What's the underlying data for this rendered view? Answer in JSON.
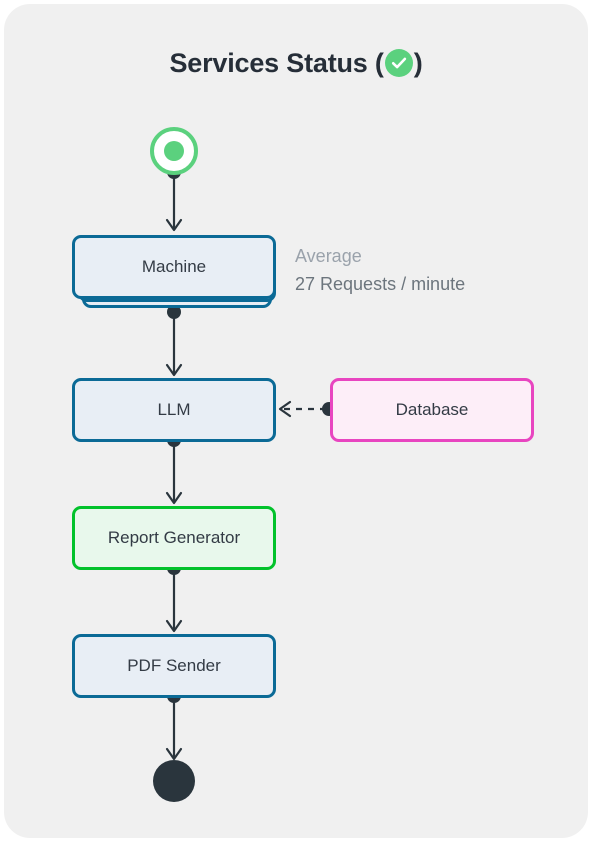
{
  "title": {
    "text_before": "Services Status (",
    "text_after": ")",
    "status_icon": "check-circle-icon",
    "status_color": "#5bd17e"
  },
  "diagram": {
    "type": "flowchart",
    "nodes": [
      {
        "id": "start",
        "label": "",
        "shape": "start-circle",
        "color": "#5bd17e"
      },
      {
        "id": "machine",
        "label": "Machine",
        "shape": "stacked-box",
        "color": "#0b6a96",
        "fill": "#e8eef5"
      },
      {
        "id": "llm",
        "label": "LLM",
        "shape": "box",
        "color": "#0b6a96",
        "fill": "#e8eef5"
      },
      {
        "id": "database",
        "label": "Database",
        "shape": "box",
        "color": "#e845c0",
        "fill": "#fdeef8"
      },
      {
        "id": "report",
        "label": "Report Generator",
        "shape": "box",
        "color": "#02c22b",
        "fill": "#e8f8ec"
      },
      {
        "id": "pdf",
        "label": "PDF Sender",
        "shape": "box",
        "color": "#0b6a96",
        "fill": "#e8eef5"
      },
      {
        "id": "end",
        "label": "",
        "shape": "end-circle",
        "color": "#2a353d"
      }
    ],
    "edges": [
      {
        "from": "start",
        "to": "machine",
        "style": "solid"
      },
      {
        "from": "machine",
        "to": "llm",
        "style": "solid"
      },
      {
        "from": "database",
        "to": "llm",
        "style": "dashed"
      },
      {
        "from": "llm",
        "to": "report",
        "style": "solid"
      },
      {
        "from": "report",
        "to": "pdf",
        "style": "solid"
      },
      {
        "from": "pdf",
        "to": "end",
        "style": "solid"
      }
    ],
    "annotation": {
      "line1": "Average",
      "line2": "27 Requests / minute"
    }
  }
}
